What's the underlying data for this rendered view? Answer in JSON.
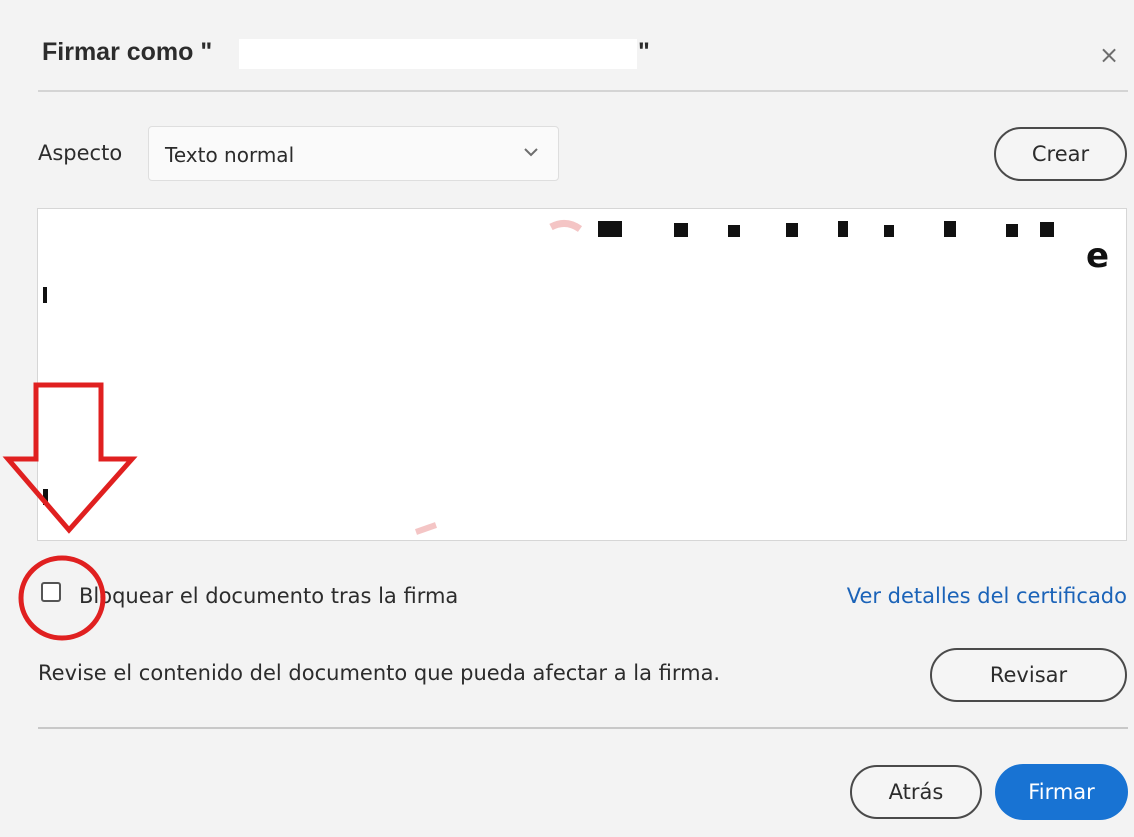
{
  "dialog": {
    "title": "Firmar como \"",
    "title_end": "\"",
    "close_glyph": "×"
  },
  "aspect": {
    "label": "Aspecto",
    "selected": "Texto normal",
    "create_label": "Crear"
  },
  "preview": {
    "visible_fragment": "e"
  },
  "options": {
    "lock_label": "Bloquear el documento tras la firma",
    "lock_checked": false,
    "cert_link": "Ver detalles del certificado"
  },
  "review": {
    "text": "Revise el contenido del documento que pueda afectar a la firma.",
    "button": "Revisar"
  },
  "footer": {
    "back": "Atrás",
    "sign": "Firmar"
  },
  "colors": {
    "accent": "#1873d3",
    "link": "#1b63b8",
    "annotation": "#e02020"
  },
  "icons": {
    "close": "close-icon",
    "dropdown": "chevron-down-icon",
    "annotation_arrow": "arrow-down-icon",
    "annotation_circle": "circle-highlight"
  }
}
